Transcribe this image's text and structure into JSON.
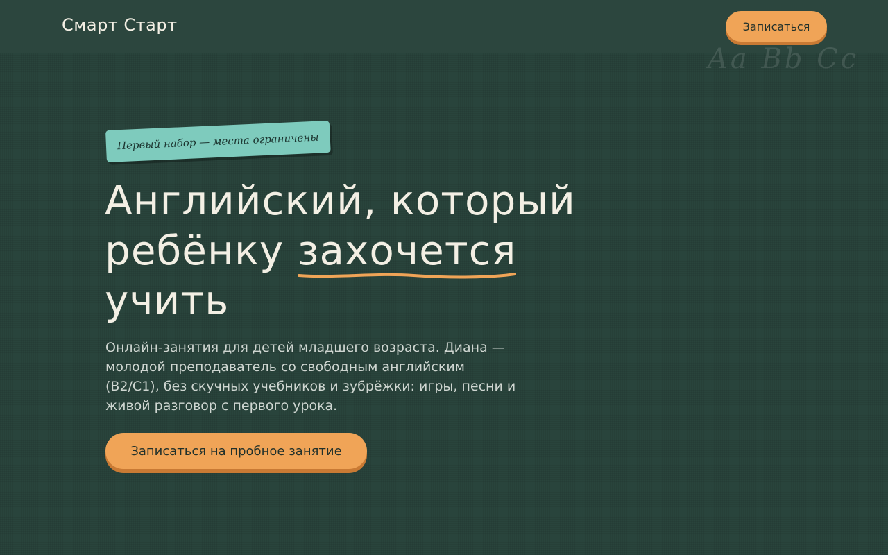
{
  "header": {
    "logo": "Смарт Старт",
    "signup_label": "Записаться"
  },
  "decor": {
    "chalk_letters": "Aa Bb Cc"
  },
  "hero": {
    "badge": "Первый набор — места ограничены",
    "headline": {
      "line1": "Английский, который",
      "line2_before": "ребёнку ",
      "line2_accent": "захочется",
      "line3": "учить"
    },
    "lead": "Онлайн-занятия для детей младшего возраста. Диана — молодой преподаватель со свободным английским (B2/C1), без скучных учебников и зубрёжки: игры, песни и живой разговор с первого урока.",
    "cta_label": "Записаться на пробное занятие"
  },
  "colors": {
    "background": "#29443c",
    "accent": "#f0a457",
    "badge": "#7ecbbd",
    "text": "#f3efe4"
  }
}
